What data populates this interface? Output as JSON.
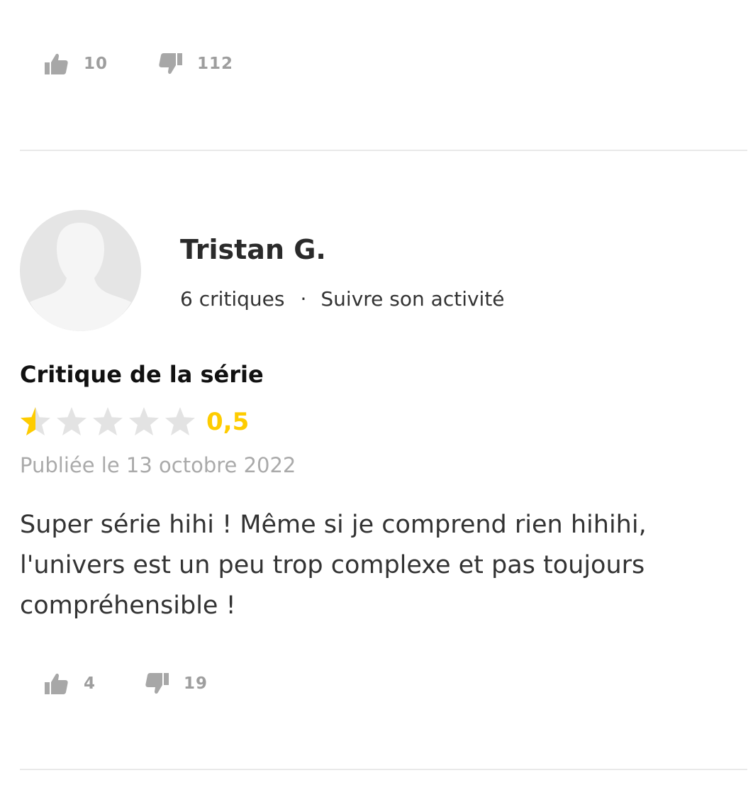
{
  "previous_review": {
    "likes": "10",
    "dislikes": "112"
  },
  "review": {
    "user": {
      "name": "Tristan G.",
      "critiques_count": "6 critiques",
      "separator": "·",
      "follow_label": "Suivre son activité",
      "avatar_icon": "default-user-silhouette-icon"
    },
    "type_label": "Critique de la série",
    "rating": {
      "value": 0.5,
      "max": 5,
      "display": "0,5"
    },
    "published": "Publiée le 13 octobre 2022",
    "text": "Super série hihi ! Même si je comprend rien hihihi, l'univers est un peu trop complexe et pas toujours compréhensible !",
    "likes": "4",
    "dislikes": "19"
  },
  "colors": {
    "star_filled": "#fecc00",
    "star_empty": "#e3e3e3",
    "vote_icon": "#a7a7a7",
    "muted_text": "#aaaaaa",
    "divider": "#e9e9e9"
  }
}
